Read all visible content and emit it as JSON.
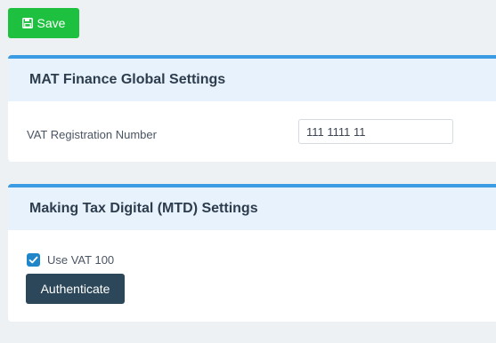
{
  "toolbar": {
    "save_label": "Save",
    "save_icon": "floppy-disk-icon",
    "save_color": "#1ec13f"
  },
  "global_settings": {
    "title": "MAT Finance Global Settings",
    "vat_label": "VAT Registration Number",
    "vat_value": "111 1111 11"
  },
  "mtd_settings": {
    "title": "Making Tax Digital (MTD) Settings",
    "use_vat100_label": "Use VAT 100",
    "use_vat100_checked": true,
    "authenticate_label": "Authenticate"
  },
  "colors": {
    "panel_accent": "#3b9be3",
    "panel_header_bg": "#e7f2fc",
    "page_bg": "#eef1f4",
    "checkbox": "#1f86c9",
    "authenticate_bg": "#2c475a"
  }
}
